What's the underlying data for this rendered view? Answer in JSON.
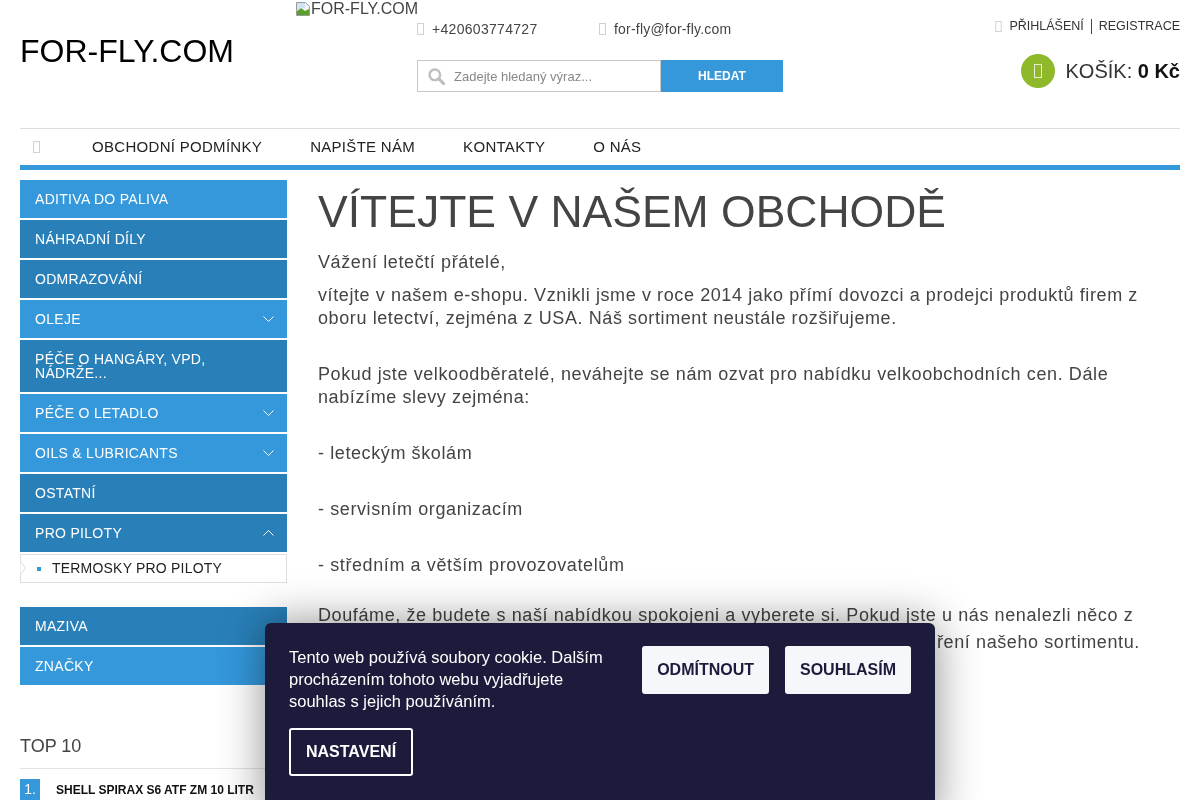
{
  "header": {
    "logo": "FOR-FLY.COM",
    "logo_image_alt": "FOR-FLY.COM",
    "phone": "+420603774727",
    "email": "for-fly@for-fly.com",
    "login": "PŘIHLÁŠENÍ",
    "register": "REGISTRACE",
    "search": {
      "placeholder": "Zadejte hledaný výraz...",
      "button": "HLEDAT"
    },
    "cart": {
      "label": "KOŠÍK:",
      "total": "0 Kč"
    }
  },
  "nav": {
    "items": [
      "OBCHODNÍ PODMÍNKY",
      "NAPIŠTE NÁM",
      "KONTAKTY",
      "O NÁS"
    ]
  },
  "sidebar": {
    "categories": [
      {
        "label": "ADITIVA DO PALIVA",
        "color": "#3498db"
      },
      {
        "label": "NÁHRADNÍ DÍLY",
        "color": "#2980b9"
      },
      {
        "label": "ODMRAZOVÁNÍ",
        "color": "#2980b9"
      },
      {
        "label": "OLEJE",
        "color": "#3498db",
        "expanded": false
      },
      {
        "label": "PÉČE O HANGÁRY, VPD, NÁDRŽE...",
        "color": "#2980b9"
      },
      {
        "label": "PÉČE O LETADLO",
        "color": "#3498db",
        "expanded": false
      },
      {
        "label": "OILS & LUBRICANTS",
        "color": "#3498db",
        "expanded": false
      },
      {
        "label": "OSTATNÍ",
        "color": "#2980b9"
      },
      {
        "label": "PRO PILOTY",
        "color": "#2980b9",
        "expanded": true,
        "children": [
          {
            "label": "TERMOSKY PRO PILOTY"
          }
        ]
      },
      {
        "label": "MAZIVA",
        "color": "#2980b9"
      },
      {
        "label": "ZNAČKY",
        "color": "#3498db"
      }
    ],
    "top10": {
      "title": "TOP 10",
      "items": [
        {
          "rank": "1.",
          "name": "SHELL SPIRAX S6 ATF ZM 10 LITR"
        }
      ]
    }
  },
  "content": {
    "title": "VÍTEJTE V NAŠEM OBCHODĚ",
    "paragraphs": [
      "Vážení letečtí přátelé,",
      "vítejte v našem e-shopu. Vznikli jsme v roce 2014 jako přímí dovozci a prodejci produktů firem z oboru letectví, zejména z USA. Náš sortiment neustále rozšiřujeme.",
      "Pokud jste velkoodběratelé, neváhejte se nám ozvat pro nabídku velkoobchodních cen. Dále nabízíme slevy zejména:",
      "- leteckým školám",
      "- servisním organizacím",
      "- středním a větším provozovatelům",
      "Doufáme, že budete s naší nabídkou spokojeni a vyberete si. Pokud jste u nás nenalezli něco z"
    ],
    "covered_line_end": "ření našeho sortimentu."
  },
  "cookie_banner": {
    "text": "Tento web používá soubory cookie. Dalším procházením tohoto webu vyjadřujete souhlas s jejich používáním.",
    "reject_button": "ODMÍTNOUT",
    "accept_button": "SOUHLASÍM",
    "settings_button": "NASTAVENÍ"
  }
}
